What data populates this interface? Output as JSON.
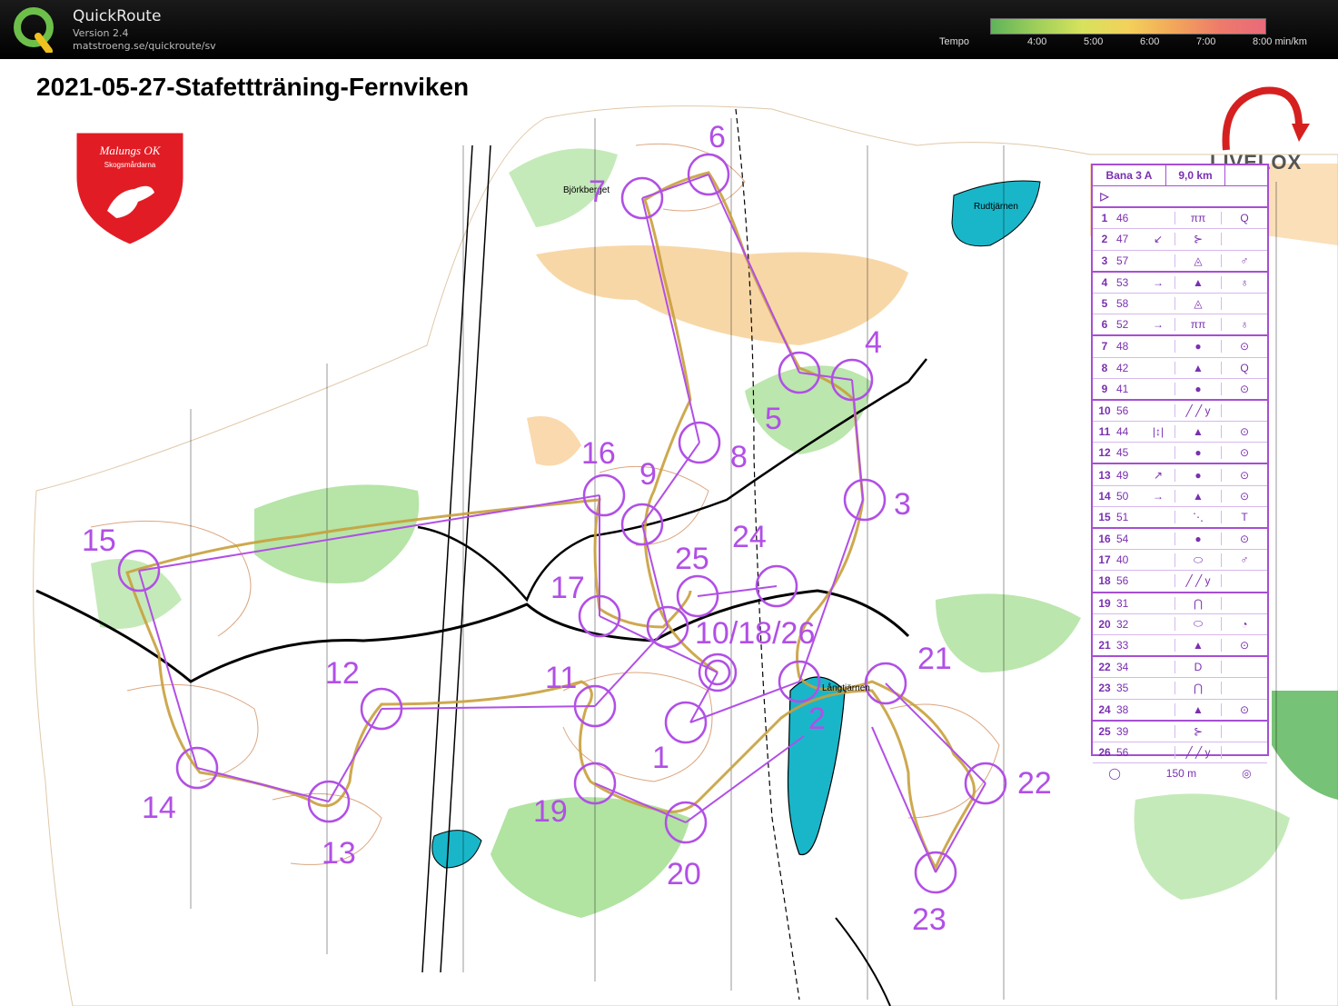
{
  "app": {
    "name": "QuickRoute",
    "version": "Version 2.4",
    "url": "matstroeng.se/quickroute/sv"
  },
  "tempo": {
    "label": "Tempo",
    "ticks": [
      "4:00",
      "5:00",
      "6:00",
      "7:00",
      "8:00  min/km"
    ]
  },
  "map": {
    "title": "2021-05-27-Stafettträning-Fernviken",
    "club_logo": {
      "line1": "Malungs OK",
      "line2": "Skogsmårdarna"
    },
    "livelox_logo": "LIVELOX",
    "place_names": [
      "Björkberget",
      "Rudtjärnen",
      "Långtjärnen"
    ],
    "controls": [
      "1",
      "2",
      "3",
      "4",
      "5",
      "6",
      "7",
      "8",
      "9",
      "10/18/26",
      "11",
      "12",
      "13",
      "14",
      "15",
      "16",
      "17",
      "19",
      "20",
      "21",
      "22",
      "23",
      "24",
      "25"
    ]
  },
  "legend": {
    "course": "Bana 3 A",
    "length": "9,0 km",
    "scale": "150 m",
    "rows": [
      {
        "n": "1",
        "code": "46",
        "dir": "",
        "sym": "ππ",
        "ex": "Q"
      },
      {
        "n": "2",
        "code": "47",
        "dir": "↙",
        "sym": "⊱",
        "ex": ""
      },
      {
        "n": "3",
        "code": "57",
        "dir": "",
        "sym": "◬",
        "ex": "♂"
      },
      {
        "n": "4",
        "code": "53",
        "dir": "→",
        "sym": "▲",
        "ex": "♁"
      },
      {
        "n": "5",
        "code": "58",
        "dir": "",
        "sym": "◬",
        "ex": ""
      },
      {
        "n": "6",
        "code": "52",
        "dir": "→",
        "sym": "ππ",
        "ex": "♁"
      },
      {
        "n": "7",
        "code": "48",
        "dir": "",
        "sym": "●",
        "ex": "⊙"
      },
      {
        "n": "8",
        "code": "42",
        "dir": "",
        "sym": "▲",
        "ex": "Q"
      },
      {
        "n": "9",
        "code": "41",
        "dir": "",
        "sym": "●",
        "ex": "⊙"
      },
      {
        "n": "10",
        "code": "56",
        "dir": "",
        "sym": "╱ ╱ y",
        "ex": ""
      },
      {
        "n": "11",
        "code": "44",
        "dir": "|↕|",
        "sym": "▲",
        "ex": "⊙"
      },
      {
        "n": "12",
        "code": "45",
        "dir": "",
        "sym": "●",
        "ex": "⊙"
      },
      {
        "n": "13",
        "code": "49",
        "dir": "↗",
        "sym": "●",
        "ex": "⊙"
      },
      {
        "n": "14",
        "code": "50",
        "dir": "→",
        "sym": "▲",
        "ex": "⊙"
      },
      {
        "n": "15",
        "code": "51",
        "dir": "",
        "sym": "⋱",
        "ex": "T"
      },
      {
        "n": "16",
        "code": "54",
        "dir": "",
        "sym": "●",
        "ex": "⊙"
      },
      {
        "n": "17",
        "code": "40",
        "dir": "",
        "sym": "⬭",
        "ex": "♂"
      },
      {
        "n": "18",
        "code": "56",
        "dir": "",
        "sym": "╱ ╱ y",
        "ex": ""
      },
      {
        "n": "19",
        "code": "31",
        "dir": "",
        "sym": "⋂",
        "ex": ""
      },
      {
        "n": "20",
        "code": "32",
        "dir": "",
        "sym": "⬭",
        "ex": "◔"
      },
      {
        "n": "21",
        "code": "33",
        "dir": "",
        "sym": "▲",
        "ex": "⊙"
      },
      {
        "n": "22",
        "code": "34",
        "dir": "",
        "sym": "D",
        "ex": ""
      },
      {
        "n": "23",
        "code": "35",
        "dir": "",
        "sym": "⋂",
        "ex": ""
      },
      {
        "n": "24",
        "code": "38",
        "dir": "",
        "sym": "▲",
        "ex": "⊙"
      },
      {
        "n": "25",
        "code": "39",
        "dir": "",
        "sym": "⊱",
        "ex": ""
      },
      {
        "n": "26",
        "code": "56",
        "dir": "",
        "sym": "╱ ╱ y",
        "ex": ""
      }
    ]
  },
  "colors": {
    "course": "#b14fe6",
    "forest": "#ffffff",
    "green": "#9edc8a",
    "open": "#f6c98a",
    "water": "#19b6c9",
    "contour": "#c46a2a"
  }
}
